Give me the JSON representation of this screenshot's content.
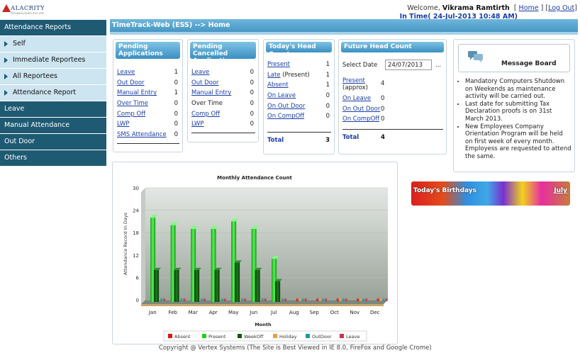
{
  "brand": {
    "name": "ALACRITY",
    "tagline": "TECHNOLOGIES PVT LTD",
    "accent": "#1f5a73"
  },
  "header": {
    "welcome_prefix": "Welcome,",
    "user_name": "Vikrama Ramtirth",
    "home_link": "Home",
    "logout_link": "Log Out",
    "in_time": "In Time( 24-Jul-2013 10:48 AM)"
  },
  "sidebar": {
    "items": [
      {
        "label": "Attendance Reports",
        "style": "dark"
      },
      {
        "label": "Self",
        "style": "light"
      },
      {
        "label": "Immediate Reportees",
        "style": "light"
      },
      {
        "label": "All Reportees",
        "style": "light"
      },
      {
        "label": "Attendance Report",
        "style": "light"
      },
      {
        "label": "Leave",
        "style": "dark"
      },
      {
        "label": "Manual Attendance",
        "style": "dark"
      },
      {
        "label": "Out Door",
        "style": "dark"
      },
      {
        "label": "Others",
        "style": "dark"
      }
    ]
  },
  "titlebar": "TimeTrack-Web (ESS) --> Home",
  "pending": {
    "title": "Pending Applications",
    "rows": [
      {
        "label": "Leave",
        "value": "1"
      },
      {
        "label": "Out Door",
        "value": "0"
      },
      {
        "label": "Manual Entry",
        "value": "1"
      },
      {
        "label": "Over Time",
        "value": "0"
      },
      {
        "label": "Comp Off",
        "value": "0"
      },
      {
        "label": "LWP",
        "value": "0"
      },
      {
        "label": "SMS Attendance",
        "value": "0"
      }
    ]
  },
  "cancelled": {
    "title": "Pending Cancelled Applications",
    "rows": [
      {
        "label": "Leave",
        "value": "0"
      },
      {
        "label": "Out Door",
        "value": "0"
      },
      {
        "label": "Manual Entry",
        "value": "0"
      },
      {
        "label": "Over Time",
        "value": "0"
      },
      {
        "label": "Comp Off",
        "value": "0"
      },
      {
        "label": "LWP",
        "value": "0"
      }
    ]
  },
  "today": {
    "title": "Today's Head Count",
    "rows": [
      {
        "label": "Present",
        "suffix": "",
        "value": "1"
      },
      {
        "label": "Late",
        "suffix": " (Present)",
        "value": "1"
      },
      {
        "label": "Absent",
        "suffix": "",
        "value": "1"
      },
      {
        "label": "On Leave",
        "suffix": "",
        "value": "0"
      },
      {
        "label": "On Out Door",
        "suffix": "",
        "value": "0"
      },
      {
        "label": "On CompOff",
        "suffix": "",
        "value": "0"
      }
    ],
    "total_label": "Total",
    "total_value": "3"
  },
  "future": {
    "title": "Future Head Count",
    "date_label": "Select Date",
    "date_value": "24/07/2013",
    "date_button": "...",
    "present_label": "Present",
    "present_sub": "(approx)",
    "present_value": "4",
    "rows": [
      {
        "label": "On Leave",
        "value": "0"
      },
      {
        "label": "On Out Door",
        "value": "0"
      },
      {
        "label": "On CompOff",
        "value": "0"
      }
    ],
    "total_label": "Total",
    "total_value": "4"
  },
  "message_board": {
    "title": "Message Board",
    "messages": [
      "Mandatory Computers Shutdown on Weekends as maintenance activity will be carried out.",
      "Last date for submitting Tax Declaration proofs is on 31st March 2013.",
      "New Employees Company Orientation Program will be held on first week of every month. Employess are requested to attend the same."
    ]
  },
  "birthdays": {
    "title": "Today's Birthdays",
    "month_link": "July"
  },
  "chart_data": {
    "type": "bar",
    "title": "Monthly Attendance Count",
    "xlabel": "Month",
    "ylabel": "Attendance Record In Days",
    "ylim": [
      0,
      30
    ],
    "yticks": [
      0,
      6,
      12,
      18,
      24,
      30
    ],
    "categories": [
      "Jan",
      "Feb",
      "Mar",
      "Apr",
      "May",
      "Jun",
      "Jul",
      "Aug",
      "Sep",
      "Oct",
      "Nov",
      "Dec"
    ],
    "series": [
      {
        "name": "Absent",
        "color": "#e01616",
        "values": [
          0,
          0,
          0,
          0,
          0,
          0,
          0,
          0,
          0,
          0,
          0,
          0
        ]
      },
      {
        "name": "Present",
        "color": "#20d020",
        "values": [
          22,
          20,
          19,
          19,
          21,
          19,
          11,
          0,
          0,
          0,
          0,
          0
        ]
      },
      {
        "name": "WeekOff",
        "color": "#0d5a0d",
        "values": [
          8,
          8,
          8,
          8,
          10,
          8,
          5,
          0,
          0,
          0,
          0,
          0
        ]
      },
      {
        "name": "Holiday",
        "color": "#f0a040",
        "values": [
          0,
          0,
          0,
          0,
          0,
          0,
          0,
          0,
          0,
          0,
          0,
          0
        ]
      },
      {
        "name": "OutDoor",
        "color": "#1a9aa8",
        "values": [
          0,
          0,
          0,
          0,
          0,
          0,
          0,
          0,
          0,
          0,
          0,
          0
        ]
      },
      {
        "name": "Leave",
        "color": "#d03050",
        "values": [
          0,
          0,
          0,
          0,
          0,
          0,
          0,
          0,
          0,
          0,
          0,
          0
        ]
      }
    ],
    "legend": "bottom"
  },
  "footer": "Copyright @ Vertex Systems (The Site is Best Viewed in IE 8.0, FireFox and Google Crome)"
}
